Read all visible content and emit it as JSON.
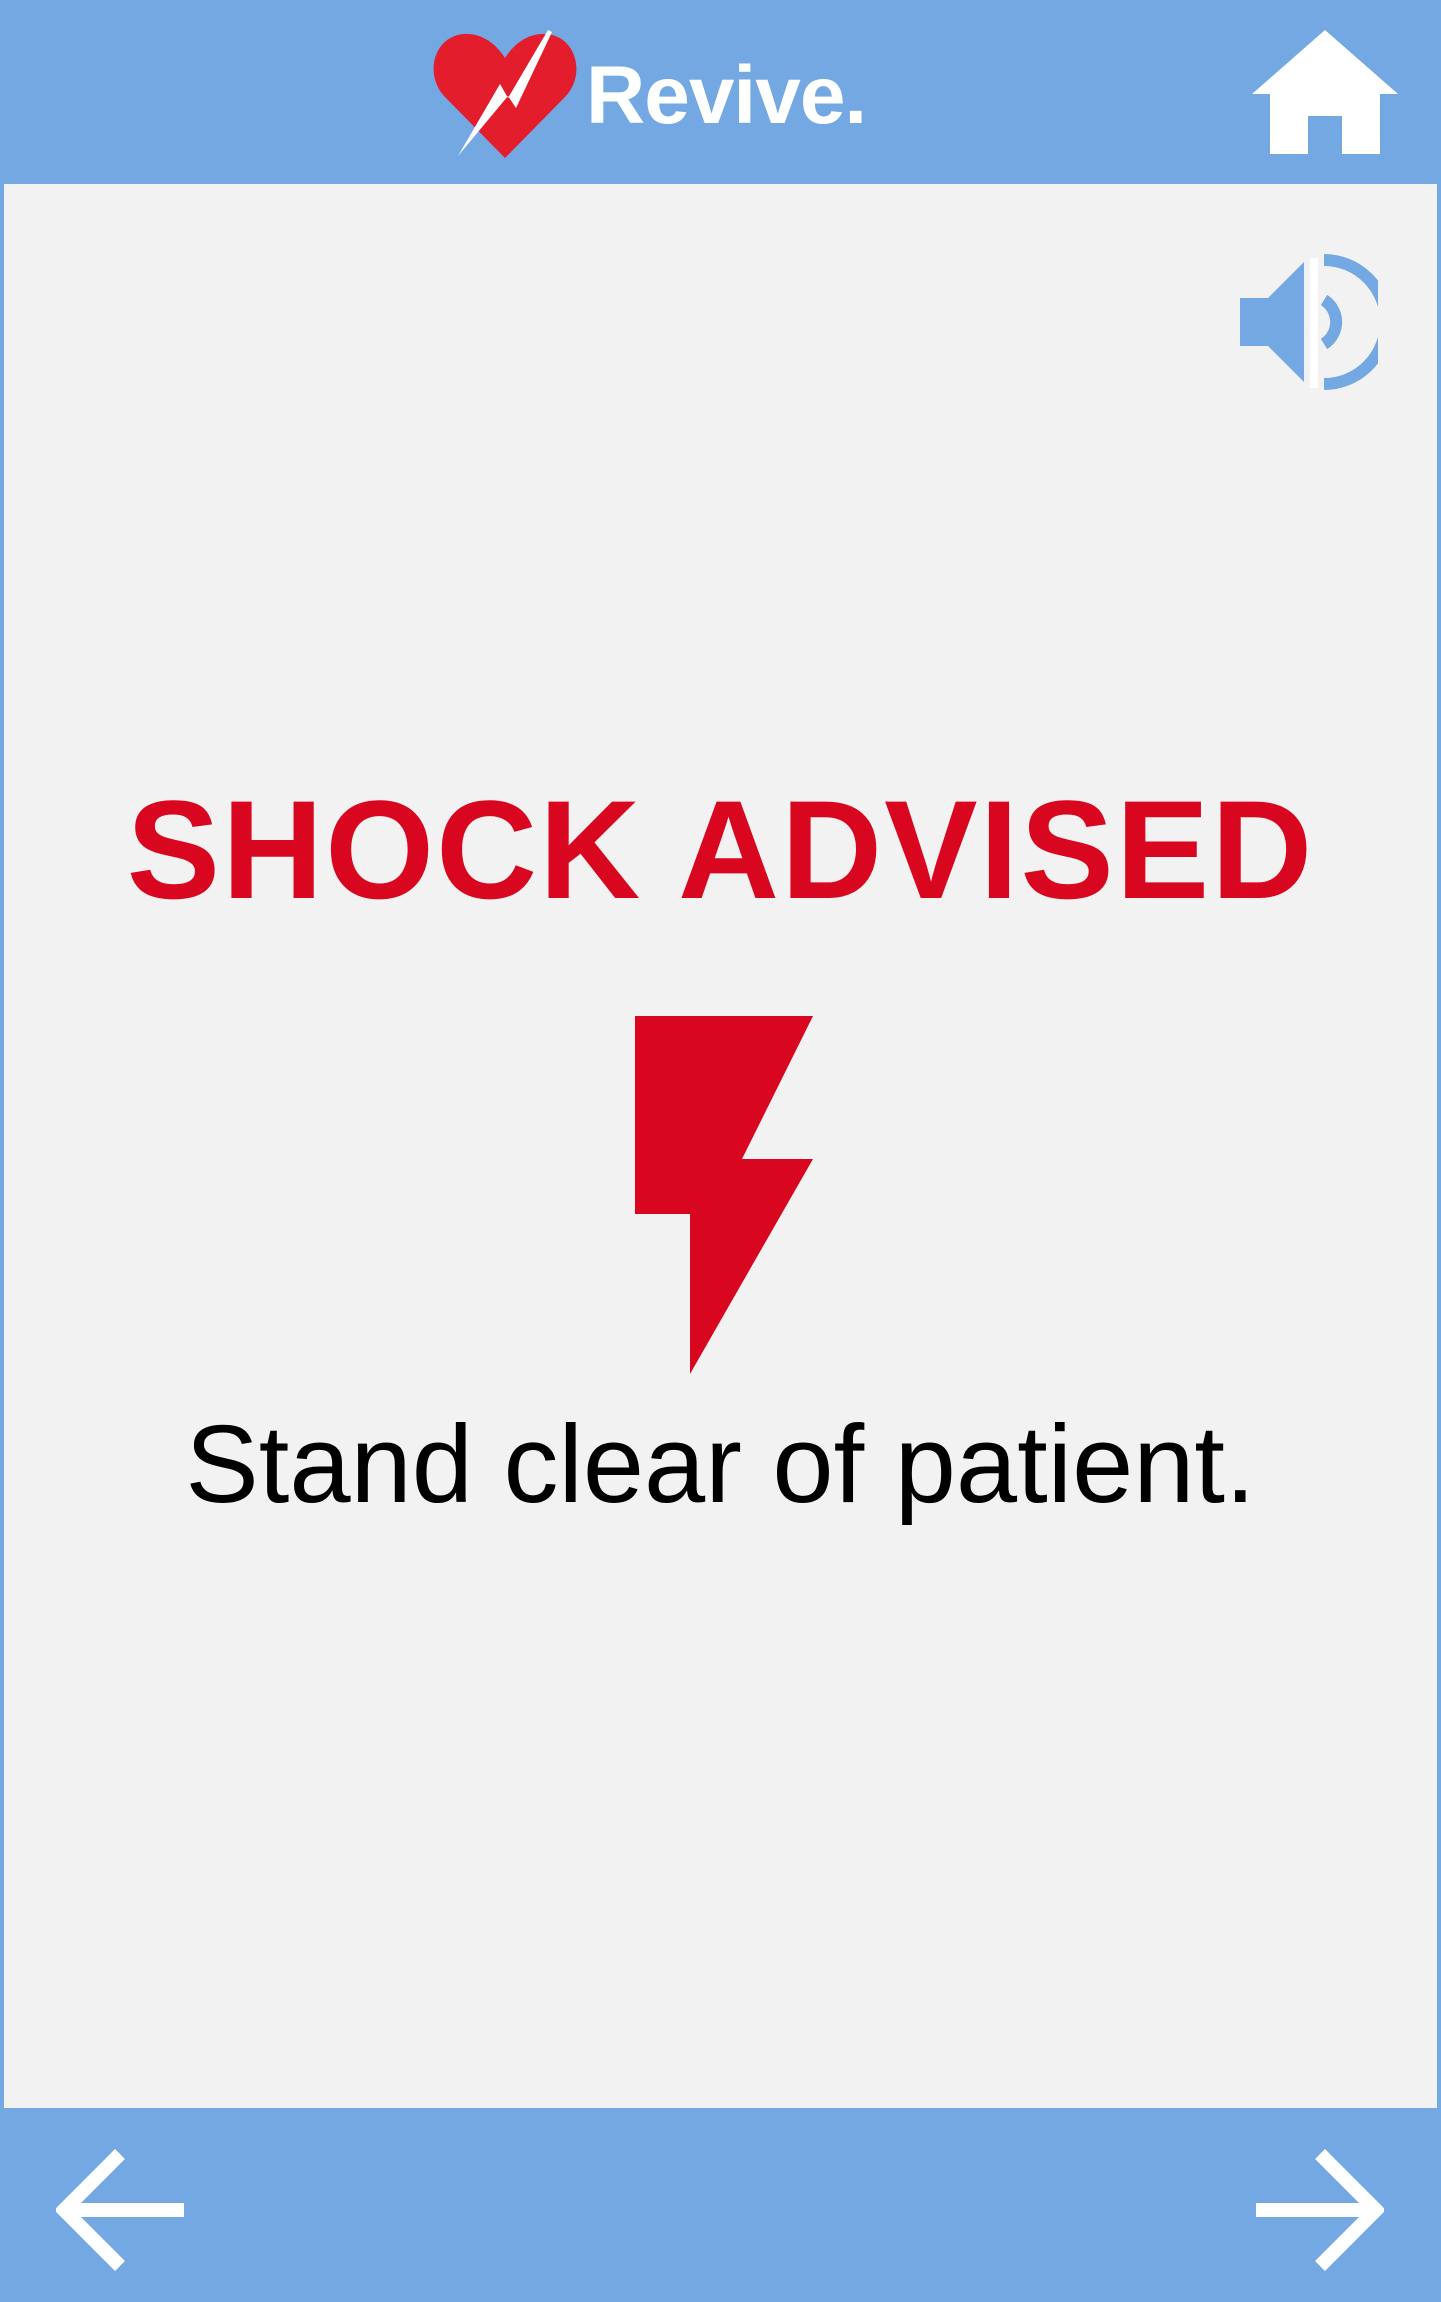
{
  "header": {
    "brand_name": "Revive.",
    "logo_icon": "heart-bolt-logo",
    "home_icon": "home-icon"
  },
  "main": {
    "audio_icon": "speaker-icon",
    "headline": "SHOCK ADVISED",
    "illustration_icon": "lightning-bolt-icon",
    "instruction": "Stand clear of patient."
  },
  "footer": {
    "back_icon": "arrow-left-icon",
    "next_icon": "arrow-right-icon"
  },
  "colors": {
    "bar_background": "#74a8e3",
    "content_background": "#f2f2f2",
    "alert_red": "#d90620",
    "text": "#000000",
    "icon_white": "#ffffff"
  }
}
